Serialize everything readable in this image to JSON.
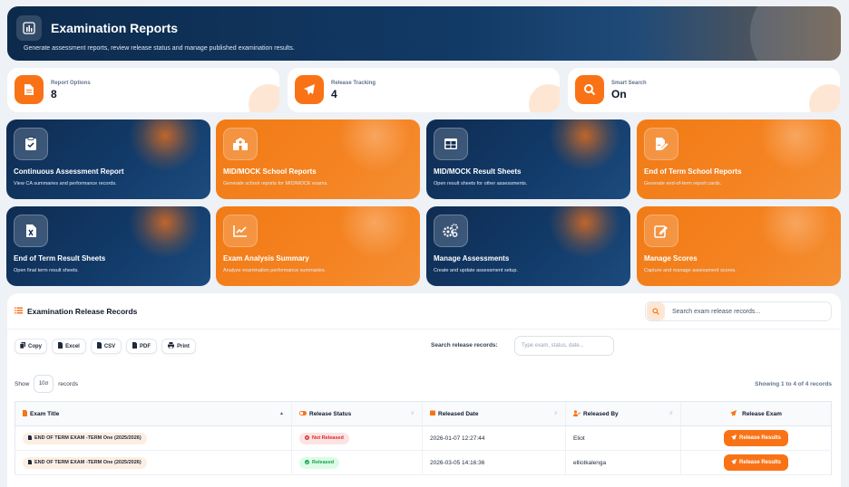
{
  "header": {
    "title": "Examination Reports",
    "subtitle": "Generate assessment reports, review release status and manage published examination results."
  },
  "stats": [
    {
      "label": "Report Options",
      "value": "8",
      "icon": "document-icon"
    },
    {
      "label": "Release Tracking",
      "value": "4",
      "icon": "paper-plane-icon"
    },
    {
      "label": "Smart Search",
      "value": "On",
      "icon": "search-icon"
    }
  ],
  "cards": [
    {
      "title": "Continuous Assessment Report",
      "desc": "View CA summaries and performance records.",
      "icon": "clipboard-check-icon",
      "theme": "navy"
    },
    {
      "title": "MID/MOCK School Reports",
      "desc": "Generate school reports for MID/MOCK exams.",
      "icon": "school-icon",
      "theme": "orange"
    },
    {
      "title": "MID/MOCK Result Sheets",
      "desc": "Open result sheets for other assessments.",
      "icon": "table-icon",
      "theme": "navy"
    },
    {
      "title": "End of Term School Reports",
      "desc": "Generate end-of-term report cards.",
      "icon": "file-signature-icon",
      "theme": "orange"
    },
    {
      "title": "End of Term Result Sheets",
      "desc": "Open final term result sheets.",
      "icon": "excel-file-icon",
      "theme": "navy"
    },
    {
      "title": "Exam Analysis Summary",
      "desc": "Analyze examination performance summaries.",
      "icon": "chart-line-icon",
      "theme": "orange"
    },
    {
      "title": "Manage Assessments",
      "desc": "Create and update assessment setup.",
      "icon": "gears-icon",
      "theme": "navy"
    },
    {
      "title": "Manage Scores",
      "desc": "Capture and manage assessment scores.",
      "icon": "edit-icon",
      "theme": "orange"
    }
  ],
  "records": {
    "title": "Examination Release Records",
    "search_placeholder": "Search exam release records...",
    "buttons": [
      "Copy",
      "Excel",
      "CSV",
      "PDF",
      "Print"
    ],
    "search_label": "Search release records:",
    "search_input_placeholder": "Type exam, status, date...",
    "show_label": "Show",
    "show_value": "10",
    "records_label": "records",
    "showing_text": "Showing 1 to 4 of 4 records",
    "columns": [
      "Exam Title",
      "Release Status",
      "Released Date",
      "Released By",
      "Release Exam"
    ],
    "rows": [
      {
        "exam": "END OF TERM EXAM -TERM One (2025/2026)",
        "status": "Not Released",
        "status_type": "red",
        "date": "2026-01-07 12:27:44",
        "by": "Eliot",
        "action": "Release Results"
      },
      {
        "exam": "END OF TERM EXAM -TERM One (2025/2026)",
        "status": "Released",
        "status_type": "green",
        "date": "2026-03-05 14:16:36",
        "by": "elliotkalenga",
        "action": "Release Results"
      }
    ]
  },
  "colors": {
    "navy": "#0f2c52",
    "orange": "#f97316",
    "background": "#eef1f5"
  }
}
